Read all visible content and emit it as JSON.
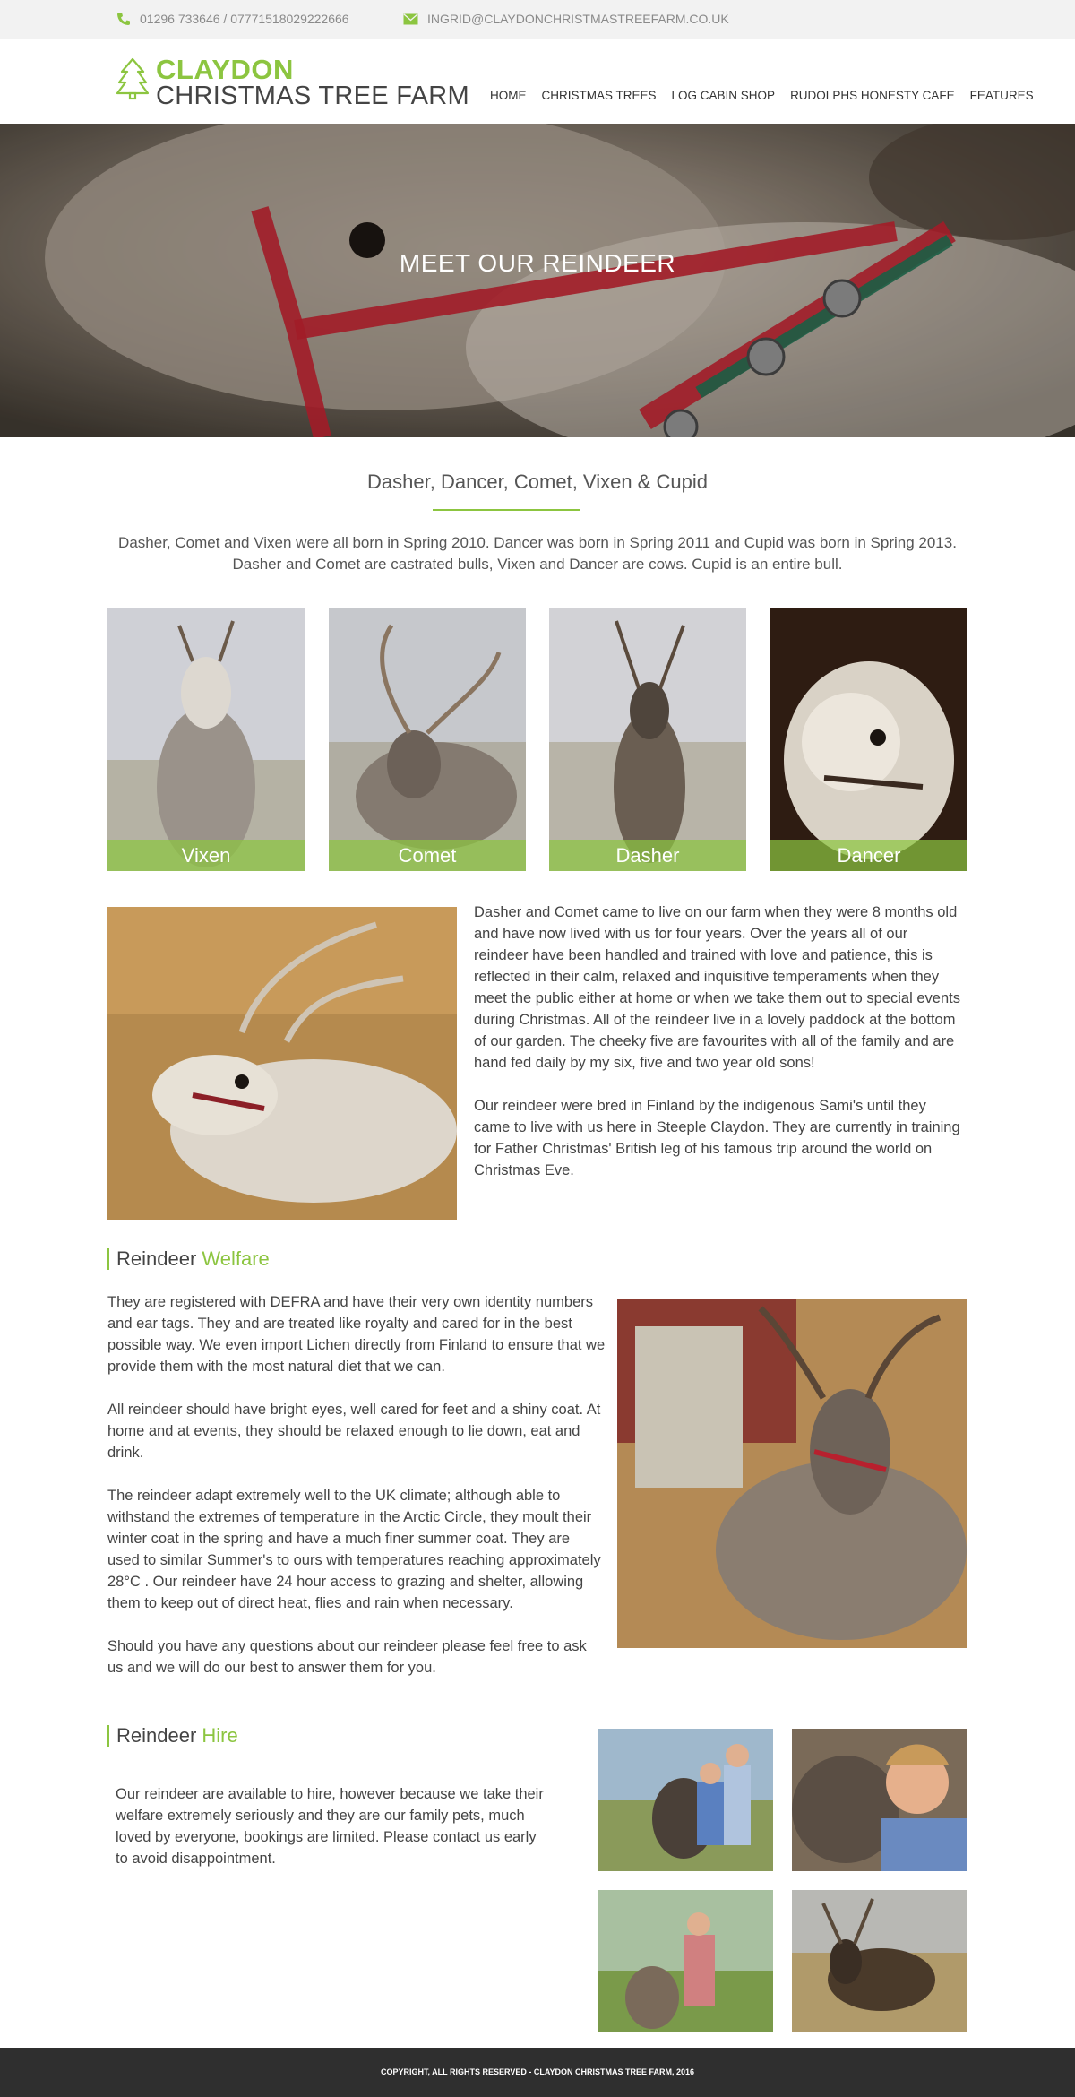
{
  "topbar": {
    "phone": "01296 733646 / 07771518029222666",
    "email": "INGRID@CLAYDONCHRISTMASTREEFARM.CO.UK"
  },
  "logo": {
    "line1": "CLAYDON",
    "line2": "CHRISTMAS TREE FARM"
  },
  "nav": [
    "HOME",
    "CHRISTMAS TREES",
    "LOG CABIN SHOP",
    "RUDOLPHS HONESTY CAFE",
    "FEATURES"
  ],
  "hero": {
    "title": "MEET OUR REINDEER"
  },
  "intro": {
    "title": "Dasher, Dancer, Comet, Vixen & Cupid",
    "line1": "Dasher, Comet and Vixen were all born in Spring 2010.  Dancer was born in Spring 2011 and Cupid was born in Spring 2013.",
    "line2": "Dasher and Comet are castrated bulls, Vixen and Dancer are cows.  Cupid is an entire bull."
  },
  "reindeer": [
    "Vixen",
    "Comet",
    "Dasher",
    "Dancer"
  ],
  "about": {
    "p1": "Dasher and Comet came to live on our farm when they were 8 months old and have now lived with us for four years.  Over the years all of our reindeer have been handled and trained with love and patience, this is reflected in their calm, relaxed and inquisitive temperaments when they meet the public either at home or when we take them out to special events during Christmas.   All of the reindeer live in a lovely paddock at the bottom of our garden.  The cheeky five are favourites with all of the family and are hand fed daily by my six, five and two year old sons!",
    "p2": "Our reindeer were bred in Finland by the indigenous Sami's until they came to live with us here in Steeple Claydon.  They are currently in training for Father Christmas' British leg of his famous trip around the world on Christmas Eve."
  },
  "welfare": {
    "title_a": "Reindeer ",
    "title_b": "Welfare",
    "p1": "They are registered with DEFRA and have their very own identity numbers and ear tags.  They and are treated like royalty and cared for in the best possible way.  We even import Lichen directly from Finland to ensure that we provide them with the most natural diet that we can.",
    "p2": "All reindeer should have bright eyes, well cared for feet and a shiny coat.  At home and at events, they should be relaxed enough to lie down, eat and drink.",
    "p3": "The reindeer adapt extremely well to the UK climate; although able to withstand the extremes of temperature in the Arctic Circle, they moult their winter coat in the spring and have a much finer summer coat.  They are used to similar Summer's to ours with temperatures reaching approximately 28°C .  Our reindeer have 24 hour access to grazing and shelter, allowing them to keep out of direct heat, flies and rain when necessary.",
    "p4": "Should you have any questions about our reindeer please feel free to ask us and we will do our best to answer them for you."
  },
  "hire": {
    "title_a": "Reindeer ",
    "title_b": "Hire",
    "p1": "Our reindeer are available to hire, however because we take their welfare extremely seriously and they are our family pets, much loved by everyone, bookings are limited.  Please contact us early to avoid disappointment."
  },
  "footer": {
    "text": "COPYRIGHT, ALL RIGHTS RESERVED - CLAYDON CHRISTMAS TREE FARM, 2016"
  },
  "colors": {
    "accent": "#8cc540",
    "footer": "#2f2f2f",
    "topbar": "#f2f2f2"
  }
}
